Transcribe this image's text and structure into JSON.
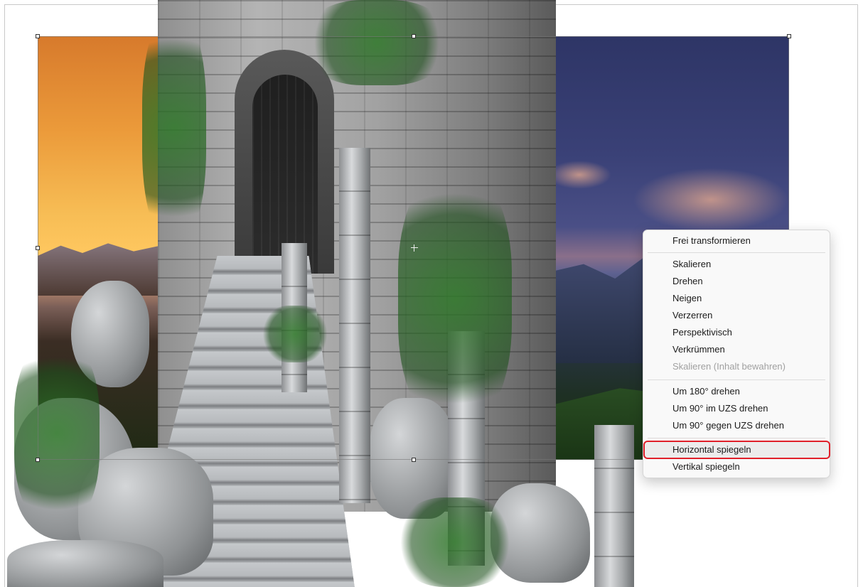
{
  "context_menu": {
    "items": [
      {
        "label": "Frei transformieren",
        "enabled": true
      },
      {
        "label": "Skalieren",
        "enabled": true
      },
      {
        "label": "Drehen",
        "enabled": true
      },
      {
        "label": "Neigen",
        "enabled": true
      },
      {
        "label": "Verzerren",
        "enabled": true
      },
      {
        "label": "Perspektivisch",
        "enabled": true
      },
      {
        "label": "Verkrümmen",
        "enabled": true
      },
      {
        "label": "Skalieren (Inhalt bewahren)",
        "enabled": false
      },
      {
        "label": "Um 180° drehen",
        "enabled": true
      },
      {
        "label": "Um 90° im UZS drehen",
        "enabled": true
      },
      {
        "label": "Um 90° gegen UZS drehen",
        "enabled": true
      },
      {
        "label": "Horizontal spiegeln",
        "enabled": true,
        "highlighted": true
      },
      {
        "label": "Vertikal spiegeln",
        "enabled": true
      }
    ],
    "highlight_color": "#e0202a"
  },
  "canvas": {
    "icons": [
      "transform-handle-icon",
      "center-point-icon"
    ]
  }
}
